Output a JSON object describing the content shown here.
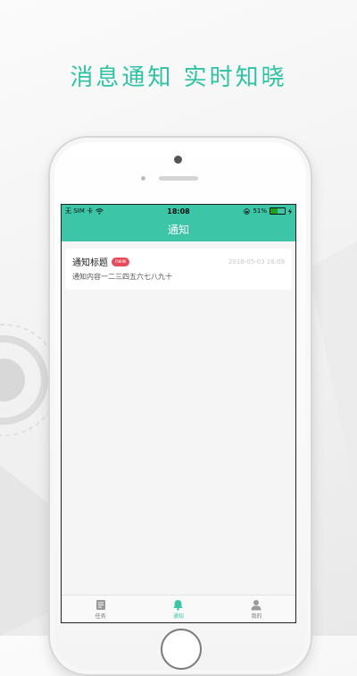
{
  "headline": "消息通知 实时知晓",
  "status_bar": {
    "carrier": "无 SIM 卡",
    "wifi_icon": "wifi-icon",
    "time": "18:08",
    "battery_percent": "51%",
    "battery_level": 0.51,
    "battery_color": "#1ea31e"
  },
  "nav": {
    "title": "通知"
  },
  "notifications": [
    {
      "title": "通知标题",
      "badge": "new",
      "date": "2018-05-03 16:09",
      "body": "通知内容一二三四五六七八九十"
    }
  ],
  "tabs": [
    {
      "label": "任务",
      "icon": "task-list-icon",
      "active": false
    },
    {
      "label": "通知",
      "icon": "bell-icon",
      "active": true
    },
    {
      "label": "我的",
      "icon": "user-icon",
      "active": false
    }
  ],
  "colors": {
    "accent": "#3cc5a6",
    "headline": "#2fc2a3",
    "badge": "#e74a5b"
  }
}
